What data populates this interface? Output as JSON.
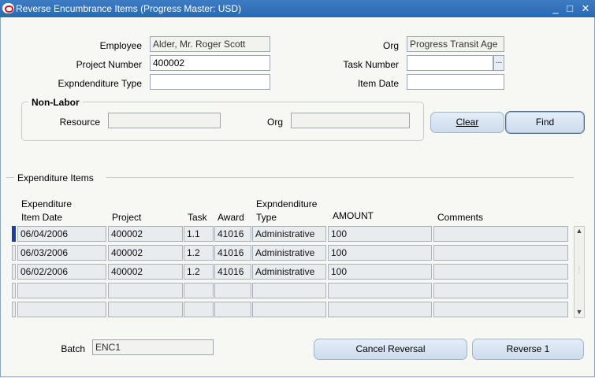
{
  "window": {
    "title": "Reverse Encumbrance Items (Progress Master: USD)",
    "controls": {
      "minimize": "_",
      "maximize": "□",
      "close": "✕"
    }
  },
  "form": {
    "employee": {
      "label": "Employee",
      "value": "Alder, Mr. Roger Scott"
    },
    "org": {
      "label": "Org",
      "value": "Progress Transit Age"
    },
    "project_number": {
      "label": "Project Number",
      "value": "400002"
    },
    "task_number": {
      "label": "Task Number",
      "value": "",
      "lov": "..."
    },
    "expenditure_type": {
      "label": "Expndenditure Type",
      "value": ""
    },
    "item_date": {
      "label": "Item Date",
      "value": ""
    }
  },
  "non_labor": {
    "title": "Non-Labor",
    "resource": {
      "label": "Resource",
      "value": ""
    },
    "org": {
      "label": "Org",
      "value": ""
    }
  },
  "buttons": {
    "clear": "Clear",
    "find": "Find",
    "cancel_reversal": "Cancel Reversal",
    "reverse": "Reverse 1"
  },
  "items": {
    "section_title": "Expenditure Items",
    "columns": {
      "item_date_1": "Expenditure",
      "item_date_2": "Item Date",
      "project": "Project",
      "task": "Task",
      "award": "Award",
      "type_1": "Expndenditure",
      "type_2": "Type",
      "amount": "AMOUNT",
      "comments": "Comments"
    },
    "rows": [
      {
        "date": "06/04/2006",
        "project": "400002",
        "task": "1.1",
        "award": "41016",
        "type": "Administrative",
        "amount": "100",
        "comments": ""
      },
      {
        "date": "06/03/2006",
        "project": "400002",
        "task": "1.2",
        "award": "41016",
        "type": "Administrative",
        "amount": "100",
        "comments": ""
      },
      {
        "date": "06/02/2006",
        "project": "400002",
        "task": "1.2",
        "award": "41016",
        "type": "Administrative",
        "amount": "100",
        "comments": ""
      },
      {
        "date": "",
        "project": "",
        "task": "",
        "award": "",
        "type": "",
        "amount": "",
        "comments": ""
      },
      {
        "date": "",
        "project": "",
        "task": "",
        "award": "",
        "type": "",
        "amount": "",
        "comments": ""
      }
    ],
    "current_row": 0
  },
  "batch": {
    "label": "Batch",
    "value": "ENC1"
  },
  "colors": {
    "titlebar": "#2c68b0",
    "current_row_indicator": "#1c3f99",
    "background": "#f7f7f4"
  }
}
